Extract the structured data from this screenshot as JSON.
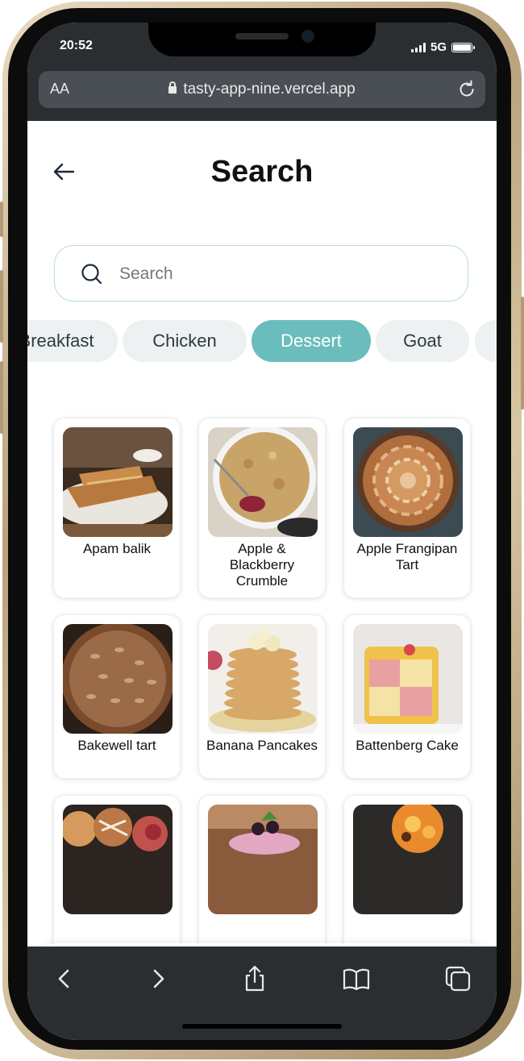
{
  "status_bar": {
    "time": "20:52",
    "network": "5G"
  },
  "browser": {
    "text_size": "AA",
    "url": "tasty-app-nine.vercel.app"
  },
  "page": {
    "title": "Search"
  },
  "search": {
    "placeholder": "Search"
  },
  "categories": {
    "items": [
      "Breakfast",
      "Chicken",
      "Dessert",
      "Goat",
      ""
    ],
    "selected": "Dessert"
  },
  "recipes": [
    {
      "name": "Apam balik"
    },
    {
      "name": "Apple & Blackberry Crumble"
    },
    {
      "name": "Apple Frangipan Tart"
    },
    {
      "name": "Bakewell tart"
    },
    {
      "name": "Banana Pancakes"
    },
    {
      "name": "Battenberg Cake"
    },
    {
      "name": ""
    },
    {
      "name": ""
    },
    {
      "name": ""
    }
  ],
  "tabbar": {
    "items": [
      "home-icon",
      "search-icon",
      "heart-icon",
      "profile-icon"
    ]
  },
  "colors": {
    "accent": "#6bbdbd",
    "chrome": "#2b2e31",
    "frame": "#c9b48e"
  }
}
